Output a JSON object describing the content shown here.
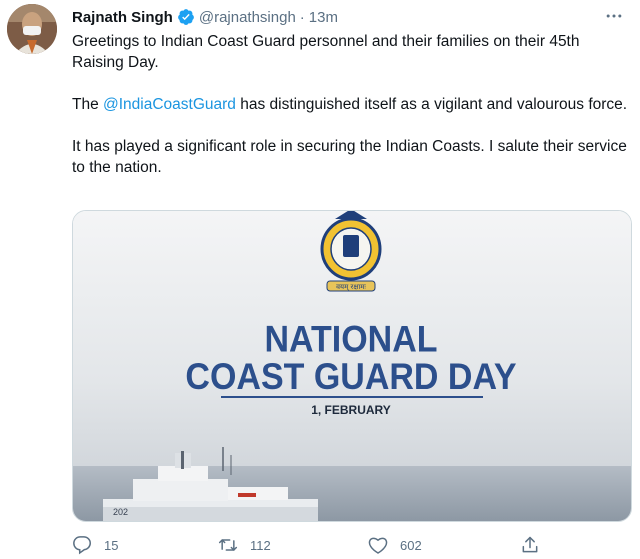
{
  "tweet": {
    "author_name": "Rajnath Singh",
    "handle": "@rajnathsingh",
    "separator": "·",
    "time": "13m",
    "paragraphs": {
      "p1": "Greetings to Indian Coast Guard personnel and their families on their 45th Raising Day.",
      "p2_pre": "The ",
      "p2_mention": "@IndiaCoastGuard",
      "p2_post": " has distinguished itself as a vigilant and valourous force.",
      "p3": "It has played a significant role in securing the Indian Coasts. I salute their service to the nation."
    },
    "media": {
      "title_line1": "NATIONAL",
      "title_line2": "COAST GUARD DAY",
      "date": "1, FEBRUARY",
      "emblem_motto": "वयम् रक्षामः",
      "ship_number": "202"
    },
    "actions": {
      "replies": "15",
      "retweets": "112",
      "likes": "602"
    },
    "icons": [
      "verified-icon",
      "more-icon",
      "reply-icon",
      "retweet-icon",
      "like-icon",
      "share-icon"
    ],
    "colors": {
      "link": "#1b95e0",
      "secondary": "#5b7083",
      "verified": "#1da1f2",
      "poster_title": "#2c4f8c"
    }
  }
}
